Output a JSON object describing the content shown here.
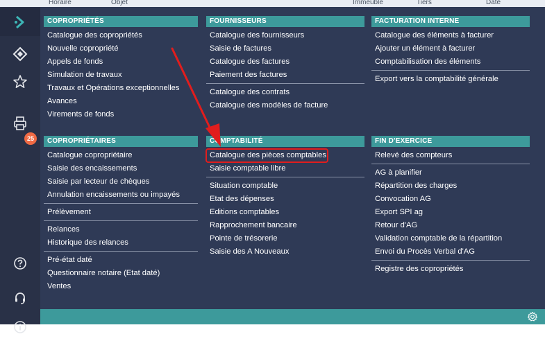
{
  "top_strip": {
    "left_text": "Horaire",
    "mid_text": "Objet",
    "right1_text": "Immeuble",
    "right2_text": "Tiers",
    "right3_text": "Date"
  },
  "sidebar": {
    "badge": "25"
  },
  "sections": [
    {
      "title": "COPROPRIÉTÉS",
      "groups": [
        [
          "Catalogue des copropriétés",
          "Nouvelle copropriété",
          "Appels de fonds",
          "Simulation de travaux",
          "Travaux et Opérations exceptionnelles",
          "Avances",
          "Virements de fonds"
        ]
      ]
    },
    {
      "title": "FOURNISSEURS",
      "groups": [
        [
          "Catalogue des fournisseurs",
          "Saisie de factures",
          "Catalogue des factures",
          "Paiement des factures"
        ],
        [
          "Catalogue des contrats",
          "Catalogue des modèles de facture"
        ]
      ]
    },
    {
      "title": "FACTURATION INTERNE",
      "groups": [
        [
          "Catalogue des éléments à facturer",
          "Ajouter un élément à facturer",
          "Comptabilisation des éléments"
        ],
        [
          "Export vers la comptabilité générale"
        ]
      ]
    },
    {
      "title": "COPROPRIÉTAIRES",
      "groups": [
        [
          "Catalogue copropriétaire",
          "Saisie des encaissements",
          "Saisie par lecteur de chèques",
          "Annulation encaissements ou impayés"
        ],
        [
          "Prélèvement"
        ],
        [
          "Relances",
          "Historique des relances"
        ],
        [
          "Pré-état daté",
          "Questionnaire notaire (Etat daté)",
          "Ventes"
        ]
      ]
    },
    {
      "title": "COMPTABILITÉ",
      "groups": [
        [
          "Catalogue des pièces comptables",
          "Saisie comptable libre"
        ],
        [
          "Situation comptable",
          "Etat des dépenses",
          "Editions comptables",
          "Rapprochement bancaire",
          "Pointe de trésorerie",
          "Saisie des A Nouveaux"
        ]
      ]
    },
    {
      "title": "FIN D'EXERCICE",
      "groups": [
        [
          "Relevé des compteurs"
        ],
        [
          "AG à planifier",
          "Répartition des charges",
          "Convocation AG",
          "Export SPI ag",
          "Retour d'AG",
          "Validation comptable de la répartition",
          "Envoi du Procès Verbal d'AG"
        ],
        [
          "Registre des copropriétés"
        ]
      ]
    }
  ],
  "icons": {
    "sidebar": [
      "chevron-right-icon",
      "diamond-nav-icon",
      "star-icon",
      "printer-icon",
      "help-icon",
      "headset-icon",
      "info-icon"
    ],
    "footer": "gear-icon"
  },
  "colors": {
    "panel": "#2f3a56",
    "sidebar": "#293147",
    "header_teal": "#3d9a9b",
    "highlight": "#e11d1d",
    "badge": "#ef6a44"
  }
}
